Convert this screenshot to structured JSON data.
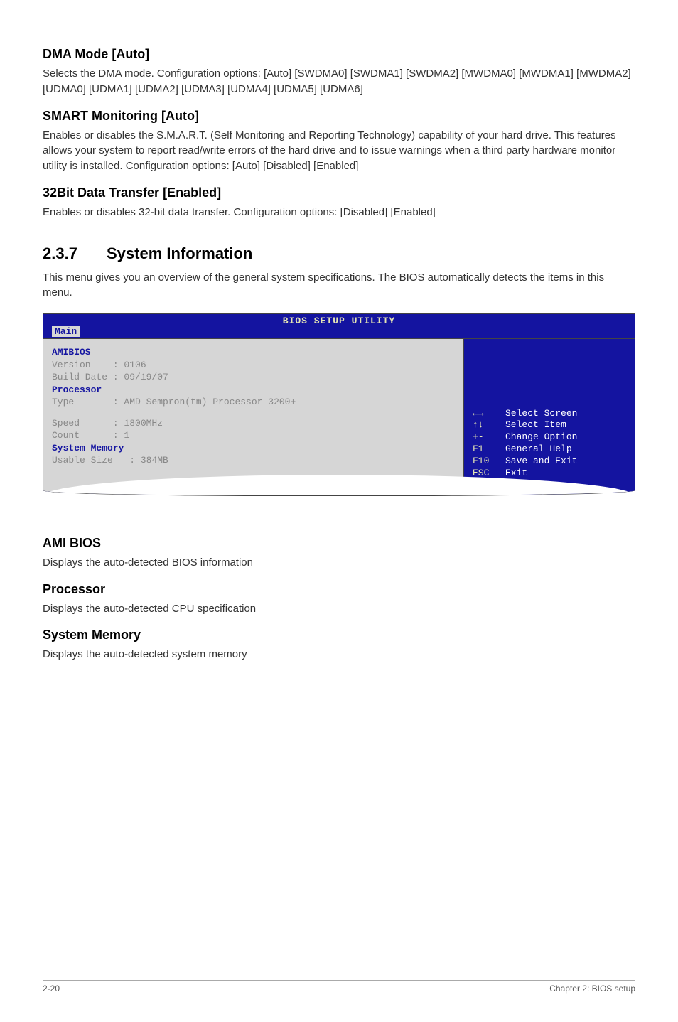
{
  "sections": {
    "dma": {
      "heading": "DMA Mode [Auto]",
      "text": "Selects the DMA mode. Configuration options: [Auto] [SWDMA0] [SWDMA1] [SWDMA2] [MWDMA0] [MWDMA1] [MWDMA2] [UDMA0] [UDMA1] [UDMA2] [UDMA3] [UDMA4] [UDMA5] [UDMA6]"
    },
    "smart": {
      "heading": "SMART Monitoring [Auto]",
      "text": "Enables or disables the S.M.A.R.T. (Self Monitoring and Reporting Technology) capability of your hard drive. This features allows your system to report read/write errors of the hard drive and to issue warnings when a third party hardware monitor utility is installed. Configuration options: [Auto] [Disabled] [Enabled]"
    },
    "bit32": {
      "heading": "32Bit Data Transfer [Enabled]",
      "text": "Enables or disables 32-bit data transfer. Configuration options: [Disabled] [Enabled]"
    },
    "sysinfo": {
      "num": "2.3.7",
      "heading": "System Information",
      "text": "This menu gives you an overview of the general system specifications. The BIOS automatically detects the items in this menu."
    },
    "amibios": {
      "heading": "AMI BIOS",
      "text": "Displays the auto-detected BIOS information"
    },
    "processor": {
      "heading": "Processor",
      "text": "Displays the auto-detected CPU specification"
    },
    "sysmem": {
      "heading": "System Memory",
      "text": "Displays the auto-detected system memory"
    }
  },
  "bios": {
    "title": "BIOS SETUP UTILITY",
    "tab": "Main",
    "amibios_label": "AMIBIOS",
    "version_label": "Version",
    "version_value": ": 0106",
    "builddate_label": "Build Date",
    "builddate_value": ": 09/19/07",
    "processor_label": "Processor",
    "type_label": "Type",
    "type_value": ": AMD Sempron(tm) Processor 3200+",
    "speed_label": "Speed",
    "speed_value": ": 1800MHz",
    "count_label": "Count",
    "count_value": ": 1",
    "sysmem_label": "System Memory",
    "usable_label": "Usable Size",
    "usable_value": ": 384MB",
    "help": {
      "k1": "←→",
      "v1": "Select Screen",
      "k2": "↑↓",
      "v2": "Select Item",
      "k3": "+-",
      "v3": "Change Option",
      "k4": "F1",
      "v4": "General Help",
      "k5": "F10",
      "v5": "Save and Exit",
      "k6": "ESC",
      "v6": "Exit"
    }
  },
  "footer": {
    "left": "2-20",
    "right": "Chapter 2: BIOS setup"
  }
}
